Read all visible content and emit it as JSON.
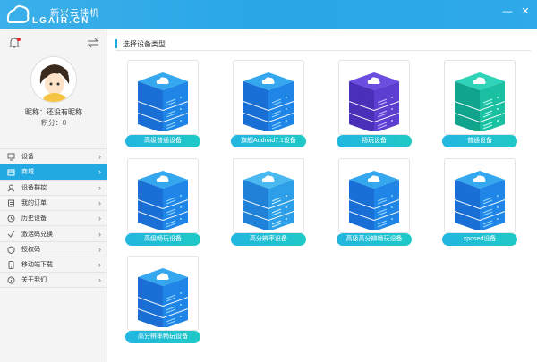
{
  "app": {
    "title": "新兴云挂机",
    "subtitle": "LGAIR.CN",
    "accent": "#23a9e1"
  },
  "window": {
    "minimize_icon": "minimize-icon",
    "close_icon": "close-icon"
  },
  "user": {
    "nickname": "昵称：还没有昵称",
    "points": "积分：0"
  },
  "sidebar": {
    "items": [
      {
        "label": "设备",
        "icon": "device-icon",
        "active": false
      },
      {
        "label": "商城",
        "icon": "store-icon",
        "active": true
      },
      {
        "label": "设备群控",
        "icon": "group-control-icon",
        "active": false
      },
      {
        "label": "我的订单",
        "icon": "order-icon",
        "active": false
      },
      {
        "label": "历史设备",
        "icon": "history-icon",
        "active": false
      },
      {
        "label": "激活码兑换",
        "icon": "redeem-icon",
        "active": false
      },
      {
        "label": "授权码",
        "icon": "auth-code-icon",
        "active": false
      },
      {
        "label": "移动端下载",
        "icon": "mobile-download-icon",
        "active": false
      },
      {
        "label": "关于我们",
        "icon": "about-icon",
        "active": false
      }
    ]
  },
  "main": {
    "section_title": "选择设备类型",
    "devices": [
      {
        "label": "高级普通设备",
        "style": "blue"
      },
      {
        "label": "旗舰Android7.1设备",
        "style": "blue"
      },
      {
        "label": "畅玩设备",
        "style": "purple"
      },
      {
        "label": "普通设备",
        "style": "green"
      },
      {
        "label": "高级畅玩设备",
        "style": "blue"
      },
      {
        "label": "高分辨率设备",
        "style": "glass"
      },
      {
        "label": "高级高分辨畅玩设备",
        "style": "blue"
      },
      {
        "label": "xposed设备",
        "style": "blue"
      },
      {
        "label": "高分辨率畅玩设备",
        "style": "blue"
      }
    ]
  }
}
